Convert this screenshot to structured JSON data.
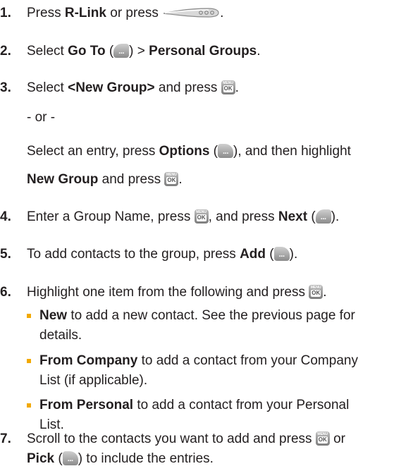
{
  "steps": [
    {
      "num": "1.",
      "parts": [
        "Press ",
        "R-Link",
        " or press ",
        "."
      ]
    },
    {
      "num": "2.",
      "parts": [
        "Select ",
        "Go To",
        " (",
        ") > ",
        "Personal Groups",
        "."
      ]
    },
    {
      "num": "3.",
      "parts": [
        "Select ",
        "<New Group>",
        " and press ",
        "."
      ],
      "or": "- or -",
      "alt": [
        "Select an entry, press ",
        "Options",
        " (",
        "), and then highlight"
      ],
      "alt2": [
        "New Group",
        " and press ",
        "."
      ]
    },
    {
      "num": "4.",
      "parts": [
        "Enter a Group Name, press ",
        ", and press ",
        "Next",
        " (",
        ")."
      ]
    },
    {
      "num": "5.",
      "parts": [
        "To add contacts to the group, press ",
        "Add",
        " (",
        ")."
      ]
    },
    {
      "num": "6.",
      "parts": [
        "Highlight one item from the following and press ",
        "."
      ],
      "bullets": [
        {
          "bold": "New",
          "text": " to add a new contact. See the previous page for",
          "cont": "details."
        },
        {
          "bold": "From Company",
          "text": " to add a contact from your Company",
          "cont": "List (if applicable)."
        },
        {
          "bold": "From Personal",
          "text": " to add a contact from your Personal",
          "cont": "List."
        }
      ]
    },
    {
      "num": "7.",
      "parts": [
        "Scroll to the contacts you want to add and press ",
        " or"
      ],
      "line2": [
        "Pick",
        " (",
        ") to include the entries."
      ]
    }
  ],
  "keys": {
    "menu_top": "MENU",
    "menu_bottom": "OK",
    "soft_dots": "···",
    "talk_dots": "ooo"
  },
  "colors": {
    "text": "#231f20",
    "bullet": "#f2a900"
  },
  "icons": [
    "talk-key-icon",
    "left-softkey-icon",
    "right-softkey-icon",
    "menu-ok-key-icon"
  ]
}
